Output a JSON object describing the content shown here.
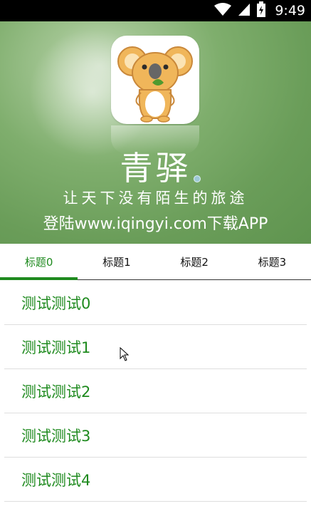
{
  "status_bar": {
    "time": "9:49",
    "icons": [
      "wifi-icon",
      "signal-icon",
      "battery-icon"
    ]
  },
  "banner": {
    "app_name": "青驿",
    "slogan": "让天下没有陌生的旅途",
    "download_text": "登陆www.iqingyi.com下载APP",
    "background_color": "#6a9d59"
  },
  "tabs": [
    {
      "label": "标题0",
      "active": true
    },
    {
      "label": "标题1",
      "active": false
    },
    {
      "label": "标题2",
      "active": false
    },
    {
      "label": "标题3",
      "active": false
    }
  ],
  "list": [
    {
      "label": "测试测试0"
    },
    {
      "label": "测试测试1"
    },
    {
      "label": "测试测试2"
    },
    {
      "label": "测试测试3"
    },
    {
      "label": "测试测试4"
    }
  ],
  "colors": {
    "accent": "#1e8a1e",
    "status_bar": "#000000"
  }
}
